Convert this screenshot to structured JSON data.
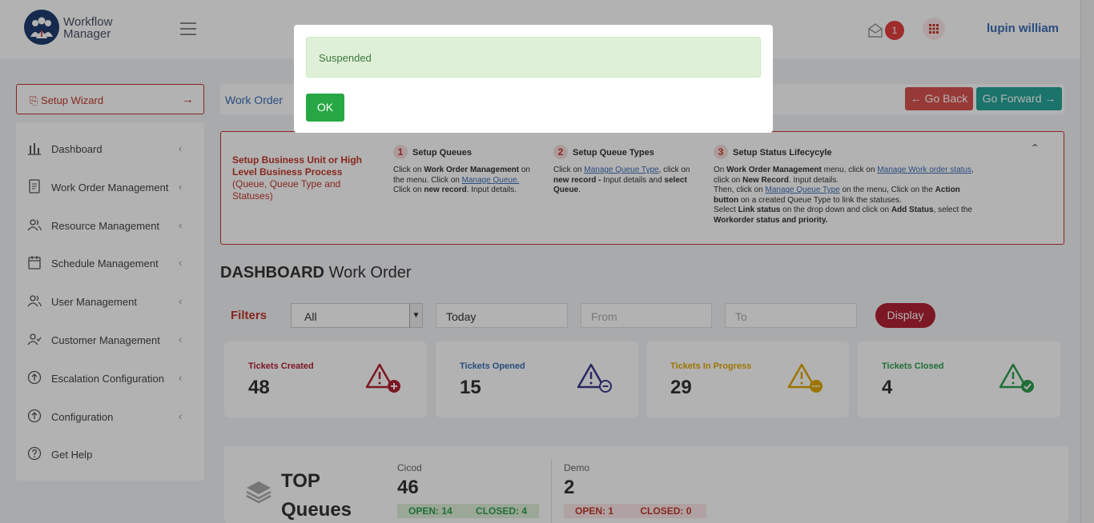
{
  "header": {
    "logo_line1": "Workflow",
    "logo_line2": "Manager",
    "notification_count": "1",
    "user_name": "lupin william"
  },
  "setup_wizard": {
    "label": "Setup Wizard"
  },
  "sidebar": {
    "items": [
      {
        "label": "Dashboard",
        "icon": "bar-chart-icon"
      },
      {
        "label": "Work Order Management",
        "icon": "document-icon"
      },
      {
        "label": "Resource Management",
        "icon": "users-icon"
      },
      {
        "label": "Schedule Management",
        "icon": "calendar-icon"
      },
      {
        "label": "User Management",
        "icon": "users-icon"
      },
      {
        "label": "Customer Management",
        "icon": "user-check-icon"
      },
      {
        "label": "Escalation Configuration",
        "icon": "upload-circle-icon"
      },
      {
        "label": "Configuration",
        "icon": "upload-circle-icon"
      },
      {
        "label": "Get Help",
        "icon": "help-circle-icon"
      }
    ]
  },
  "breadcrumb": {
    "current": "Work Order",
    "go_back": "Go Back",
    "go_forward": "Go Forward"
  },
  "setup_box": {
    "title_bold": "Setup Business Unit or High Level Business Process",
    "title_sub": "(Queue, Queue Type and Statuses)",
    "steps": [
      {
        "num": "1",
        "head": "Setup Queues",
        "t1": "Click on ",
        "b1": "Work Order Management",
        "t2": " on the menu. Click on ",
        "link1": "Manage Queue.",
        "t3": " Click on ",
        "b2": "new record",
        "t4": ". Input details."
      },
      {
        "num": "2",
        "head": "Setup Queue Types",
        "t1": "Click on ",
        "link1": "Manage Queue Type",
        "t2": ", click on ",
        "b1": "new record -",
        "t3": " Input details and ",
        "b2": "select Queue",
        "t4": "."
      },
      {
        "num": "3",
        "head": "Setup Status Lifecycyle",
        "t1": "On ",
        "b1": "Work Order Management",
        "t2": " menu, click on ",
        "link1": "Manage Work order status",
        "t3": ", click on ",
        "b2": "New Record",
        "t4": ". Input details.",
        "t5": "Then, click on ",
        "link2": "Manage Queue Type",
        "t6": " on the menu, Click on the ",
        "b3": "Action button",
        "t7": " on a created Queue Type to link the statuses.",
        "t8": "Select ",
        "b4": "Link status",
        "t9": " on the drop down and click on ",
        "b5": "Add Status",
        "t10": ", select the ",
        "b6": "Workorder status and priority."
      }
    ]
  },
  "dashboard": {
    "title_bold": "DASHBOARD",
    "title_rest": "Work Order",
    "filters_label": "Filters",
    "filter_select": "All",
    "filter_period": "Today",
    "from_placeholder": "From",
    "to_placeholder": "To",
    "display_button": "Display"
  },
  "cards": [
    {
      "title": "Tickets Created",
      "value": "48",
      "color": "#b22234",
      "icon": "warning-plus-icon"
    },
    {
      "title": "Tickets Opened",
      "value": "15",
      "color": "#3d6db5",
      "icon": "warning-minus-icon"
    },
    {
      "title": "Tickets In Progress",
      "value": "29",
      "color": "#e0a800",
      "icon": "warning-dots-icon"
    },
    {
      "title": "Tickets Closed",
      "value": "4",
      "color": "#2e9e4f",
      "icon": "warning-check-icon"
    }
  ],
  "top_queues": {
    "title_line1": "TOP",
    "title_line2": "Queues",
    "queues": [
      {
        "name": "Cicod",
        "value": "46",
        "open": "OPEN: 14",
        "closed": "CLOSED: 4"
      },
      {
        "name": "Demo",
        "value": "2",
        "open": "OPEN: 1",
        "closed": "CLOSED: 0"
      }
    ]
  },
  "modal": {
    "message": "Suspended",
    "ok_label": "OK"
  }
}
